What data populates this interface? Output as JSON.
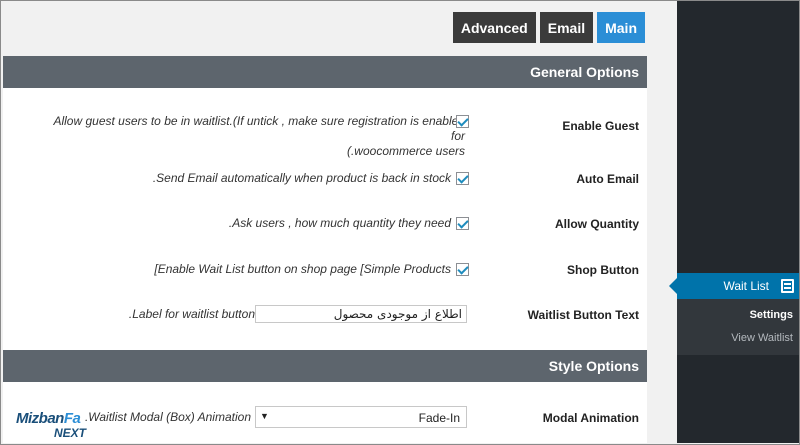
{
  "tabs": [
    {
      "label": "Advanced",
      "active": false
    },
    {
      "label": "Email",
      "active": false
    },
    {
      "label": "Main",
      "active": true
    }
  ],
  "sections": {
    "general": "General Options",
    "style": "Style Options"
  },
  "options": {
    "enable_guest": {
      "label": "Enable Guest",
      "desc_line1": "Allow guest users to be in waitlist.(If untick , make sure registration is enabled for",
      "desc_line2": "(.woocommerce users",
      "checked": true
    },
    "auto_email": {
      "label": "Auto Email",
      "desc": ".Send Email automatically when product is back in stock",
      "checked": true
    },
    "allow_quantity": {
      "label": "Allow Quantity",
      "desc": ".Ask users , how much quantity they need",
      "checked": true
    },
    "shop_button": {
      "label": "Shop Button",
      "desc": "[Enable Wait List button on shop page [Simple Products",
      "checked": true
    },
    "waitlist_button_text": {
      "label": "Waitlist Button Text",
      "value": "اطلاع از موجودی محصول",
      "desc": ".Label for waitlist button"
    },
    "modal_animation": {
      "label": "Modal Animation",
      "value": "Fade-In",
      "desc": ".Waitlist Modal (Box) Animation"
    }
  },
  "sidebar": {
    "active_item": "Wait List",
    "submenu": [
      {
        "label": "Settings",
        "current": true
      },
      {
        "label": "View Waitlist",
        "current": false
      }
    ]
  },
  "logo": {
    "line1_a": "Mizban",
    "line1_b": "Fa",
    "line2": "NEXT"
  },
  "colors": {
    "accent": "#2b8ed6",
    "section_header": "#5d656d",
    "sidebar_bg": "#23282d",
    "sidebar_active": "#0073aa"
  }
}
